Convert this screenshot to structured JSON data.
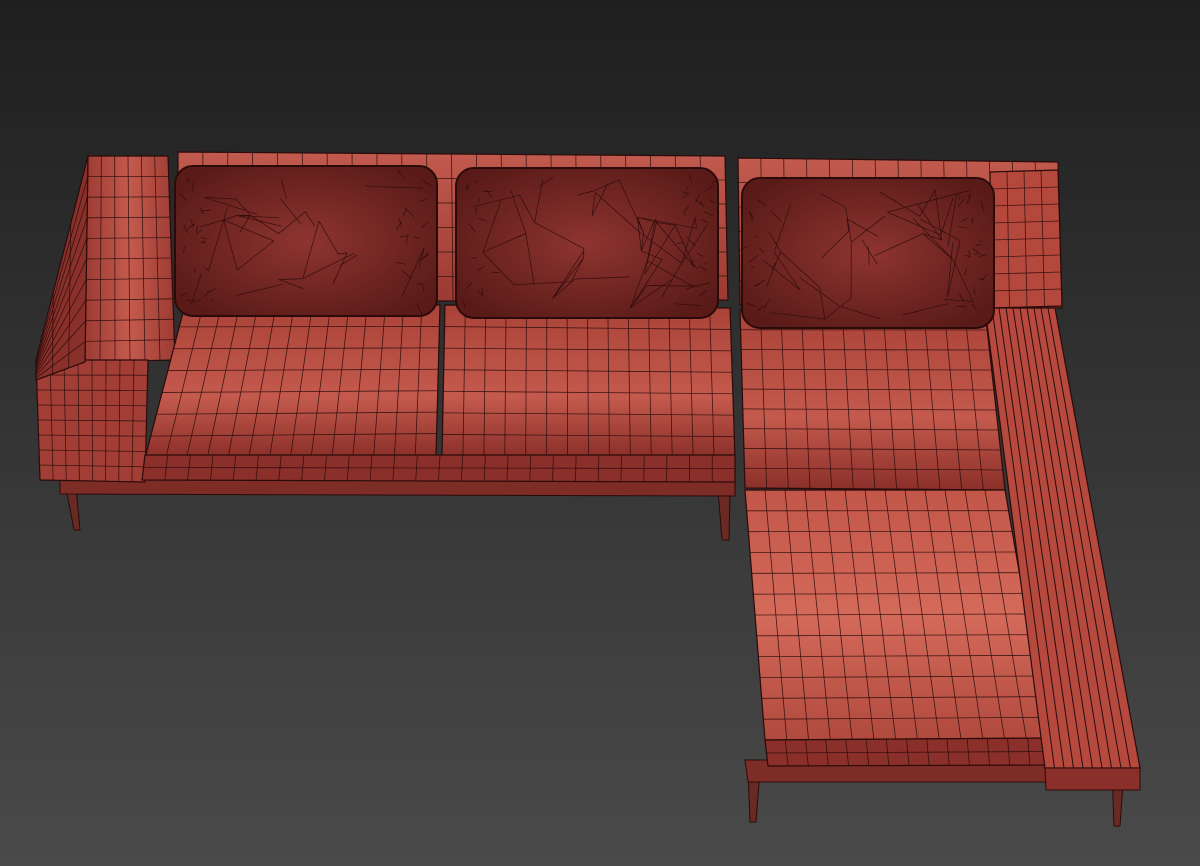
{
  "viewport": {
    "background_top": "#1f1f1f",
    "background_bottom": "#4a4a4a"
  },
  "model": {
    "subject": "sectional-sofa",
    "render_style": "wireframe-on-shaded",
    "surface_color": "#b0473c",
    "surface_highlight": "#d26a5c",
    "surface_shadow": "#6e2420",
    "wire_color": "#2a0b0a",
    "pillow_color": "#7a2a26",
    "leg_color": "#6a2a24"
  }
}
